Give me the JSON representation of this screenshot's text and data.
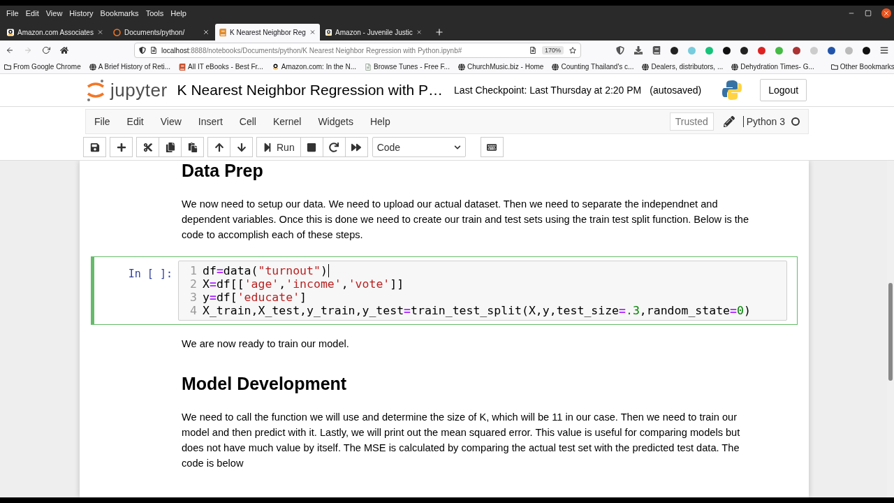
{
  "browser": {
    "menu": [
      "File",
      "Edit",
      "View",
      "History",
      "Bookmarks",
      "Tools",
      "Help"
    ],
    "tabs": [
      {
        "title": "Amazon.com Associates",
        "selected": false
      },
      {
        "title": "Documents/python/",
        "selected": false
      },
      {
        "title": "K Nearest Neighbor Reg",
        "selected": true
      },
      {
        "title": "Amazon - Juvenile Justic",
        "selected": false
      }
    ],
    "url_host": "localhost",
    "url_rest": ":8888/notebooks/Documents/python/K Nearest Neighbor Regression with Python.ipynb#",
    "zoom": "170%",
    "bookmarks": [
      "From Google Chrome",
      "A Brief History of Reti...",
      "All IT eBooks - Best Fr...",
      "Amazon.com: In the N...",
      "Browse Tunes - Free F...",
      "ChurchMusic.biz - Home",
      "Counting Thailand's c...",
      "Dealers, distributors, ...",
      "Dehydration Times- G..."
    ],
    "other_bookmarks": "Other Bookmarks"
  },
  "jupyter": {
    "logo": "jupyter",
    "title": "K Nearest Neighbor Regression with P…",
    "checkpoint": "Last Checkpoint: Last Thursday at 2:20 PM",
    "autosaved": "(autosaved)",
    "logout": "Logout",
    "menu": [
      "File",
      "Edit",
      "View",
      "Insert",
      "Cell",
      "Kernel",
      "Widgets",
      "Help"
    ],
    "trusted": "Trusted",
    "kernel": "Python 3",
    "run": "Run",
    "cell_type": "Code"
  },
  "cells": [
    {
      "kind": "heading",
      "text": "Data Prep"
    },
    {
      "kind": "markdown",
      "text": "We now need to setup our data. We need to upload our actual dataset. Then we need to separate the independnet and dependent variables. Once this is done we need to create our train and test sets using the train test split function. Below is the code to accomplish each of these steps."
    },
    {
      "kind": "code",
      "prompt": "In [ ]:",
      "selected": true,
      "lines": [
        {
          "number": "1",
          "tokens": [
            {
              "text": "df",
              "kind": "name"
            },
            {
              "text": "=",
              "kind": "operator"
            },
            {
              "text": "data(",
              "kind": "name"
            },
            {
              "text": "\"turnout\"",
              "kind": "string"
            },
            {
              "text": ")",
              "kind": "name"
            }
          ]
        },
        {
          "number": "2",
          "tokens": [
            {
              "text": "X",
              "kind": "name"
            },
            {
              "text": "=",
              "kind": "operator"
            },
            {
              "text": "df[[",
              "kind": "name"
            },
            {
              "text": "'age'",
              "kind": "string"
            },
            {
              "text": ",",
              "kind": "name"
            },
            {
              "text": "'income'",
              "kind": "string"
            },
            {
              "text": ",",
              "kind": "name"
            },
            {
              "text": "'vote'",
              "kind": "string"
            },
            {
              "text": "]]",
              "kind": "name"
            }
          ]
        },
        {
          "number": "3",
          "tokens": [
            {
              "text": "y",
              "kind": "name"
            },
            {
              "text": "=",
              "kind": "operator"
            },
            {
              "text": "df[",
              "kind": "name"
            },
            {
              "text": "'educate'",
              "kind": "string"
            },
            {
              "text": "]",
              "kind": "name"
            }
          ]
        },
        {
          "number": "4",
          "tokens": [
            {
              "text": "X_train,X_test,y_train,y_test",
              "kind": "name"
            },
            {
              "text": "=",
              "kind": "operator"
            },
            {
              "text": "train_test_split(X,y,test_size",
              "kind": "name"
            },
            {
              "text": "=",
              "kind": "operator"
            },
            {
              "text": ".3",
              "kind": "number"
            },
            {
              "text": ",random_state",
              "kind": "name"
            },
            {
              "text": "=",
              "kind": "operator"
            },
            {
              "text": "0",
              "kind": "number"
            },
            {
              "text": ")",
              "kind": "name"
            }
          ]
        }
      ]
    },
    {
      "kind": "markdown",
      "text": "We are now ready to train our model."
    },
    {
      "kind": "heading",
      "text": "Model Development"
    },
    {
      "kind": "markdown",
      "text": "We need to call the function we will use and determine the size of K, which will be 11 in our case. Then we need to train our model and then predict with it. Lastly, we will print out the mean squared error. This value is useful for comparing models but does not have much value by itself. The MSE is calculated by comparing the actual test set with the predicted test data. The code is below"
    }
  ]
}
